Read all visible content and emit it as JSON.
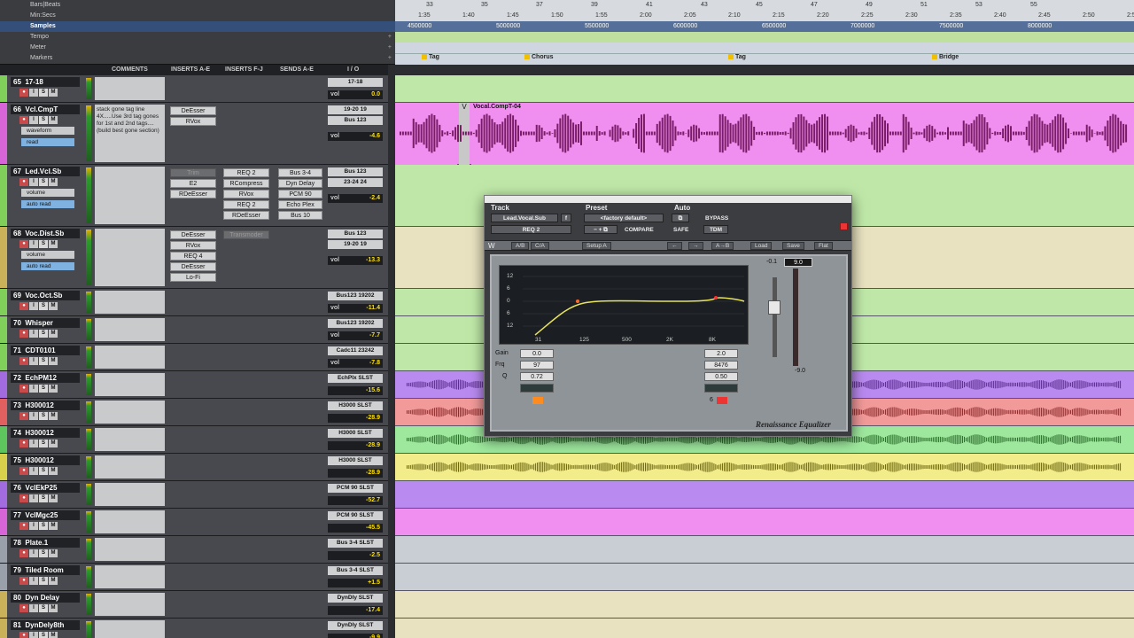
{
  "ruler": {
    "labels": [
      "Bars|Beats",
      "Min:Secs",
      "Samples",
      "Tempo",
      "Meter",
      "Markers"
    ],
    "bars": [
      "33",
      "35",
      "37",
      "39",
      "41",
      "43",
      "45",
      "47",
      "49",
      "51",
      "53",
      "55"
    ],
    "minsecs": [
      "1:35",
      "1:40",
      "1:45",
      "1:50",
      "1:55",
      "2:00",
      "2:05",
      "2:10",
      "2:15",
      "2:20",
      "2:25",
      "2:30",
      "2:35",
      "2:40",
      "2:45",
      "2:50",
      "2:55"
    ],
    "samples": [
      "4500000",
      "5000000",
      "5500000",
      "6000000",
      "6500000",
      "7000000",
      "7500000",
      "8000000"
    ],
    "markers": [
      "Tag",
      "Chorus",
      "Tag",
      "Bridge"
    ]
  },
  "columns": {
    "comments": "COMMENTS",
    "inserts_ae": "INSERTS A-E",
    "inserts_fj": "INSERTS F-J",
    "sends_ae": "SENDS A-E",
    "io": "I / O"
  },
  "tracks": [
    {
      "num": "65",
      "name": "17-18",
      "io_in": "17-18",
      "vol_label": "vol",
      "vol": "0.0",
      "mode": "read",
      "color": "#7fcf5a"
    },
    {
      "num": "66",
      "name": "Vcl.CmpT",
      "io_in": "19-20 19",
      "io_out": "Bus 123",
      "vol_label": "vol",
      "vol": "-4.6",
      "view": "waveform",
      "auto": "dyn",
      "mode": "read",
      "comment": "stack gone tag line 4X.....Use 3rd tag gones for 1st and 2nd tags....(build best gone section)",
      "inserts": [
        "DeEsser",
        "RVox"
      ],
      "color": "#d865d8",
      "region": "Vocal.CompT-04"
    },
    {
      "num": "67",
      "name": "Led.Vcl.Sb",
      "io_in": "Bus 123",
      "io_out": "23-24 24",
      "vol_label": "vol",
      "vol": "-2.4",
      "view": "volume",
      "mode": "auto read",
      "inserts": [
        "Trim",
        "E2",
        "RDeEsser"
      ],
      "inserts2": [
        "REQ 2",
        "RCompress",
        "RVox",
        "REQ 2",
        "RDeEsser"
      ],
      "sends": [
        "Bus 3-4",
        "Dyn Delay",
        "PCM 90",
        "Echo Plex",
        "Bus 10"
      ],
      "color": "#7fcf5a"
    },
    {
      "num": "68",
      "name": "Voc.Dist.Sb",
      "io_in": "Bus 123",
      "io_out": "19-20 19",
      "vol_label": "vol",
      "vol": "-13.3",
      "view": "volume",
      "mode": "auto read",
      "inserts": [
        "DeEsser",
        "RVox",
        "REQ 4",
        "DeEsser",
        "Lo-Fi"
      ],
      "inserts2": [
        "Transmoder"
      ],
      "color": "#c9b15a"
    },
    {
      "num": "69",
      "name": "Voc.Oct.Sb",
      "io_in": "Bus123 19202",
      "vol_label": "vol",
      "vol": "-11.4",
      "color": "#7fcf5a"
    },
    {
      "num": "70",
      "name": "Whisper",
      "io_in": "Bus123 19202",
      "vol_label": "vol",
      "vol": "-7.7",
      "color": "#7fcf5a"
    },
    {
      "num": "71",
      "name": "CDT0101",
      "io_in": "Cadc11 23242",
      "vol_label": "vol",
      "vol": "-7.8",
      "color": "#7fcf5a"
    },
    {
      "num": "72",
      "name": "EchPM12",
      "io_in": "EchPlx SLST",
      "vol": "-15.6",
      "color": "#a36be0"
    },
    {
      "num": "73",
      "name": "H300012",
      "io_in": "H3000 SLST",
      "vol": "-28.9",
      "color": "#e06060"
    },
    {
      "num": "74",
      "name": "H300012",
      "io_in": "H3000 SLST",
      "vol": "-28.9",
      "color": "#5ec55e"
    },
    {
      "num": "75",
      "name": "H300012",
      "io_in": "H3000 SLST",
      "vol": "-28.9",
      "color": "#d8cf4a"
    },
    {
      "num": "76",
      "name": "VclEkP25",
      "io_in": "PCM 90 SLST",
      "vol": "-52.7",
      "color": "#a36be0"
    },
    {
      "num": "77",
      "name": "VclMgc25",
      "io_in": "PCM 90 SLST",
      "vol": "-45.5",
      "color": "#d865d8"
    },
    {
      "num": "78",
      "name": "Plate.1",
      "io_in": "Bus 3-4 SLST",
      "vol": "-2.5",
      "color": "#9aa0aa"
    },
    {
      "num": "79",
      "name": "Tiled Room",
      "io_in": "Bus 3-4 SLST",
      "vol": "+1.5",
      "color": "#9aa0aa"
    },
    {
      "num": "80",
      "name": "Dyn Delay",
      "io_in": "DynDly SLST",
      "vol": "-17.4",
      "color": "#c9b15a"
    },
    {
      "num": "81",
      "name": "DynDely8th",
      "io_in": "DynDly SLST",
      "vol": "-9.9",
      "color": "#c9b15a"
    }
  ],
  "plugin": {
    "track_label": "Track",
    "preset_label": "Preset",
    "auto_label": "Auto",
    "track_name": "Lead.Vocal.Sub",
    "insert_letter": "f",
    "insert_name": "REQ 2",
    "preset_name": "<factory default>",
    "compare": "COMPARE",
    "bypass": "BYPASS",
    "safe": "SAFE",
    "tdm": "TDM",
    "toolbar": [
      "A/B",
      "C/A",
      "Setup A",
      "←",
      "→",
      "A→B",
      "Load",
      "Save",
      "Flat"
    ],
    "db_scale": [
      "12",
      "6",
      "0",
      "6",
      "12"
    ],
    "freq_scale": [
      "31",
      "125",
      "500",
      "2K",
      "8K"
    ],
    "out_top": "-0.1",
    "out_value": "9.0",
    "out_bottom": "-9.0",
    "param_labels": [
      "Gain",
      "Frq",
      "Q"
    ],
    "band1": {
      "gain": "0.0",
      "freq": "97",
      "q": "0.72"
    },
    "band6": {
      "gain": "2.0",
      "freq": "8476",
      "q": "0.50"
    },
    "band6_num": "6",
    "brand": "Renaissance Equalizer"
  },
  "colors": {
    "accent": "#54709a",
    "plugin_bg": "#3a3c40",
    "eq_curve": "#e8e45a"
  }
}
